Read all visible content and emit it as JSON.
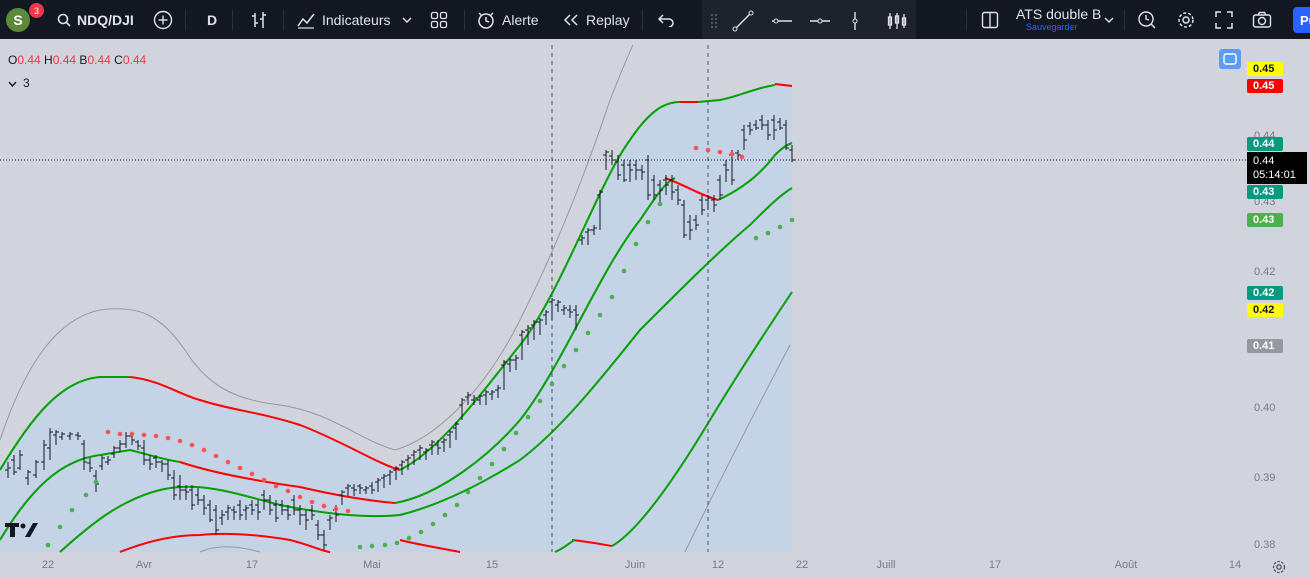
{
  "header": {
    "avatar_letter": "S",
    "notification_count": "3",
    "symbol": "NDQ/DJI",
    "interval": "D",
    "indicators_label": "Indicateurs",
    "alert_label": "Alerte",
    "replay_label": "Replay",
    "layout_name": "ATS double B",
    "save_label": "Sauvegarder",
    "publish_label": "Pu"
  },
  "legend": {
    "o_label": "O",
    "o_value": "0.44",
    "h_label": "H",
    "h_value": "0.44",
    "b_label": "B",
    "b_value": "0.44",
    "c_label": "C",
    "c_value": "0.44",
    "indicator_count": "3"
  },
  "price_axis": {
    "ticks": [
      "0.44",
      "0.43",
      "0.42",
      "0.40",
      "0.39",
      "0.38"
    ],
    "labels": [
      {
        "text": "0.45",
        "bg": "#ffff00",
        "fg": "#131722"
      },
      {
        "text": "0.45",
        "bg": "#ff0000",
        "fg": "#ffffff"
      },
      {
        "text": "0.44",
        "bg": "#089981",
        "fg": "#ffffff"
      },
      {
        "text": "0.43",
        "bg": "#089981",
        "fg": "#ffffff"
      },
      {
        "text": "0.43",
        "bg": "#4caf50",
        "fg": "#ffffff"
      },
      {
        "text": "0.42",
        "bg": "#089981",
        "fg": "#ffffff"
      },
      {
        "text": "0.42",
        "bg": "#ffff00",
        "fg": "#131722"
      },
      {
        "text": "0.41",
        "bg": "#9598a1",
        "fg": "#ffffff"
      }
    ],
    "current_price": "0.44",
    "countdown": "05:14:01"
  },
  "time_axis": {
    "ticks": [
      "22",
      "Avr",
      "17",
      "Mai",
      "15",
      "Juin",
      "12",
      "22",
      "Juill",
      "17",
      "Août",
      "14"
    ]
  },
  "colors": {
    "background": "#d1d4dc",
    "band_fill": "#c5d3e6",
    "upper_band": "#ff0000",
    "middle_band": "#089981",
    "green_line": "#00a000",
    "sar_up": "#4caf50",
    "sar_down": "#ff5252"
  }
}
